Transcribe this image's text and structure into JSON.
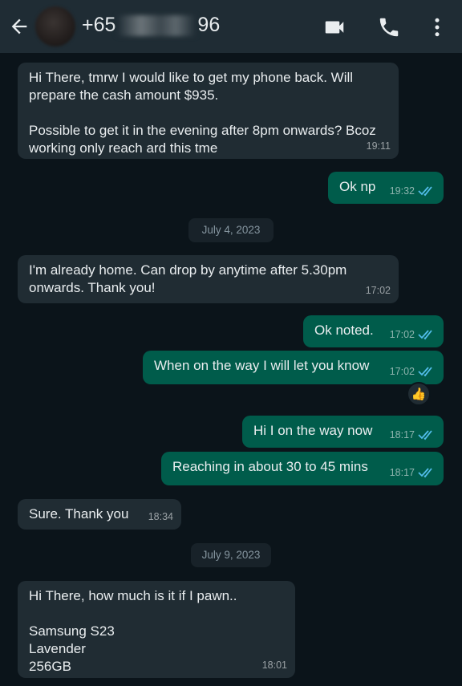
{
  "header": {
    "contact_prefix": "+65",
    "contact_suffix": "96",
    "icons": [
      "back-arrow-icon",
      "video-call-icon",
      "phone-call-icon",
      "more-options-icon"
    ]
  },
  "colors": {
    "header_bg": "#1f2c34",
    "chat_bg": "#0b141a",
    "incoming_bubble": "#202c33",
    "outgoing_bubble": "#005c4b",
    "read_tick": "#53bdeb"
  },
  "messages": [
    {
      "dir": "in",
      "text": "Hi There, tmrw I would like to get my phone back. Will prepare the cash amount $935.\n\nPossible to get it in the evening after 8pm onwards? Bcoz working only reach ard this tme",
      "time": "19:11"
    },
    {
      "dir": "out",
      "text": "Ok np",
      "time": "19:32",
      "read": true
    },
    {
      "dir": "date",
      "text": "July 4, 2023"
    },
    {
      "dir": "in",
      "text": "I'm already home. Can drop by anytime after 5.30pm onwards. Thank you!",
      "time": "17:02"
    },
    {
      "dir": "out",
      "text": "Ok noted.",
      "time": "17:02",
      "read": true
    },
    {
      "dir": "out",
      "text": "When on the way I will let you know",
      "time": "17:02",
      "read": true,
      "reaction": "👍"
    },
    {
      "dir": "out",
      "text": "Hi I on the way now",
      "time": "18:17",
      "read": true
    },
    {
      "dir": "out",
      "text": "Reaching in about 30 to 45 mins",
      "time": "18:17",
      "read": true
    },
    {
      "dir": "in",
      "text": "Sure. Thank you",
      "time": "18:34"
    },
    {
      "dir": "date",
      "text": "July 9, 2023"
    },
    {
      "dir": "in",
      "text": "Hi There, how much is it if I pawn..\n\nSamsung S23\nLavender\n256GB",
      "time": "18:01"
    }
  ]
}
